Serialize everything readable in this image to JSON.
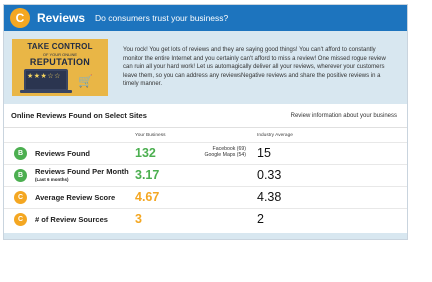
{
  "header": {
    "grade": "C",
    "title": "Reviews",
    "question": "Do consumers trust your business?",
    "grade_color": "#f4a722",
    "bar_color": "#1d74be"
  },
  "promo": {
    "image": {
      "line1": "TAKE CONTROL",
      "line2": "OF YOUR ONLINE",
      "line3": "REPUTATION",
      "stars": "★★★☆☆",
      "icons": [
        "laptop-icon",
        "cart-icon"
      ]
    },
    "text": "You rock! You get lots of reviews and they are saying good things! You can't afford to constantly monitor the entire Internet and you certainly can't afford to miss a review! One missed rogue review can ruin all your hard work! Let us automagically deliver all your reviews, wherever your customers leave them, so you can address any reviewsNegative reviews and share the positive reviews in a timely manner."
  },
  "reviews_table": {
    "title": "Online Reviews Found on Select Sites",
    "info_link": "Review information about your business",
    "col_yours": "Your Business",
    "col_industry": "Industry Average",
    "rows": [
      {
        "grade": "B",
        "grade_color": "#4caf50",
        "label": "Reviews Found",
        "sublabel": "",
        "yours": "132",
        "yours_color": "#4caf50",
        "sources": [
          "Facebook (69)",
          "Google Maps (54)"
        ],
        "industry": "15"
      },
      {
        "grade": "B",
        "grade_color": "#4caf50",
        "label": "Reviews Found Per Month",
        "sublabel": "(Last 6 months)",
        "yours": "3.17",
        "yours_color": "#4caf50",
        "sources": [],
        "industry": "0.33"
      },
      {
        "grade": "C",
        "grade_color": "#f4a722",
        "label": "Average Review Score",
        "sublabel": "",
        "yours": "4.67",
        "yours_color": "#f4a722",
        "sources": [],
        "industry": "4.38"
      },
      {
        "grade": "C",
        "grade_color": "#f4a722",
        "label": "# of Review Sources",
        "sublabel": "",
        "yours": "3",
        "yours_color": "#f4a722",
        "sources": [],
        "industry": "2"
      }
    ]
  }
}
